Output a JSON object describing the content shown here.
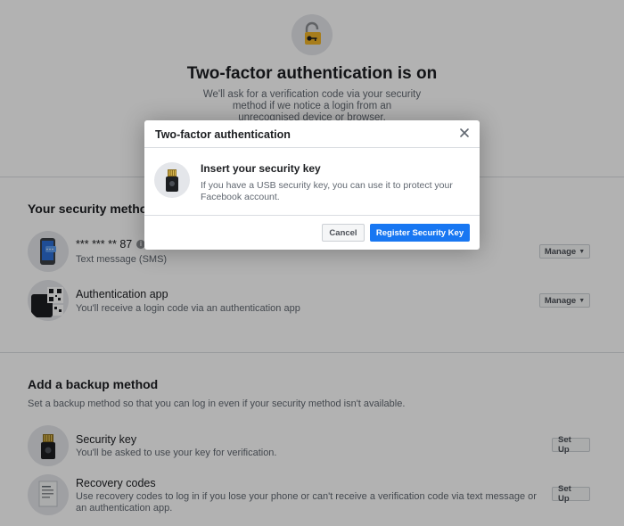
{
  "hero": {
    "title": "Two-factor authentication is on",
    "description": "We'll ask for a verification code via your security method if we notice a login from an unrecognised device or browser."
  },
  "security_methods": {
    "title": "Your security methods",
    "items": [
      {
        "title": "*** *** ** 87",
        "subtitle": "Text message (SMS)",
        "button": "Manage"
      },
      {
        "title": "Authentication app",
        "subtitle": "You'll receive a login code via an authentication app",
        "button": "Manage"
      }
    ]
  },
  "backup": {
    "title": "Add a backup method",
    "description": "Set a backup method so that you can log in even if your security method isn't available.",
    "items": [
      {
        "title": "Security key",
        "subtitle": "You'll be asked to use your key for verification.",
        "button": "Set Up"
      },
      {
        "title": "Recovery codes",
        "subtitle": "Use recovery codes to log in if you lose your phone or can't receive a verification code via text message or an authentication app.",
        "button": "Set Up"
      }
    ]
  },
  "dialog": {
    "title": "Two-factor authentication",
    "heading": "Insert your security key",
    "body": "If you have a USB security key, you can use it to protect your Facebook account.",
    "cancel_label": "Cancel",
    "confirm_label": "Register Security Key"
  },
  "colors": {
    "primary": "#1877f2",
    "overlay": "rgba(0,0,0,0.30)",
    "lock": "#f0b429"
  },
  "icons": [
    "lock-icon",
    "phone-icon",
    "qr-code-icon",
    "security-key-icon",
    "document-icon",
    "close-icon",
    "info-icon"
  ]
}
